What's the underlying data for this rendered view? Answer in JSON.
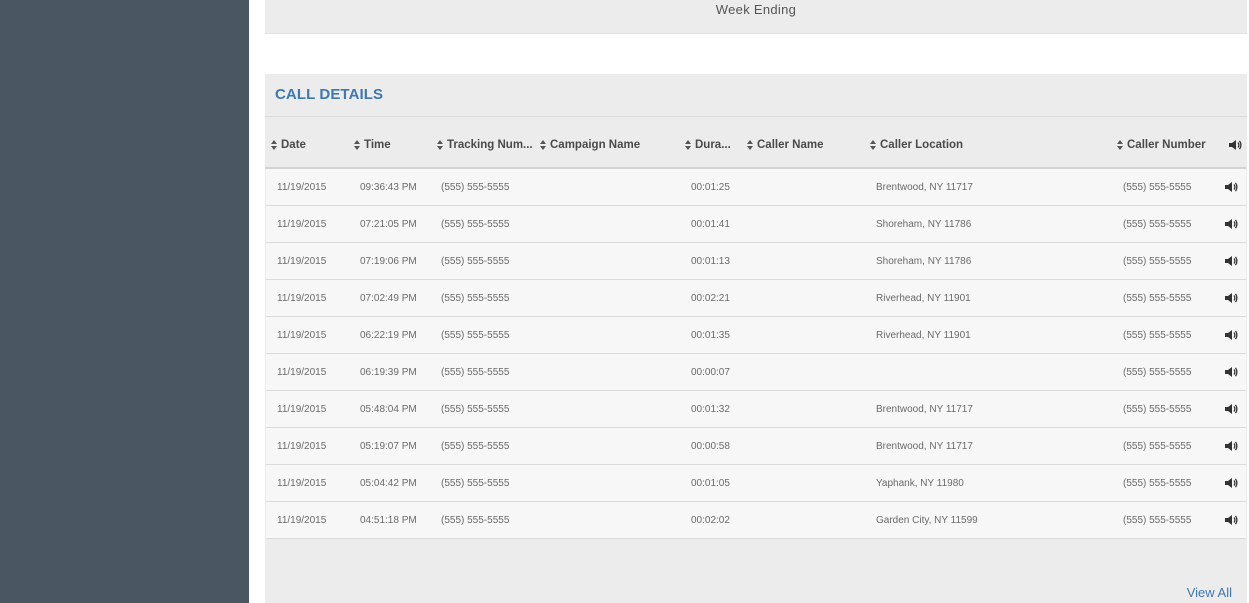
{
  "week_panel": {
    "label": "Week Ending"
  },
  "call_details": {
    "title": "CALL DETAILS",
    "columns": [
      {
        "key": "date",
        "label": "Date"
      },
      {
        "key": "time",
        "label": "Time"
      },
      {
        "key": "tracking",
        "label": "Tracking Num..."
      },
      {
        "key": "campaign",
        "label": "Campaign Name"
      },
      {
        "key": "duration",
        "label": "Dura..."
      },
      {
        "key": "caller_name",
        "label": "Caller Name"
      },
      {
        "key": "caller_location",
        "label": "Caller Location"
      },
      {
        "key": "caller_number",
        "label": "Caller Number"
      }
    ],
    "audio_icon": "speaker-icon",
    "rows": [
      {
        "date": "11/19/2015",
        "time": "09:36:43 PM",
        "tracking": "(555) 555-5555",
        "campaign": "",
        "duration": "00:01:25",
        "caller_name": "",
        "caller_location": "Brentwood, NY 11717",
        "caller_number": "(555) 555-5555"
      },
      {
        "date": "11/19/2015",
        "time": "07:21:05 PM",
        "tracking": "(555) 555-5555",
        "campaign": "",
        "duration": "00:01:41",
        "caller_name": "",
        "caller_location": "Shoreham, NY 11786",
        "caller_number": "(555) 555-5555"
      },
      {
        "date": "11/19/2015",
        "time": "07:19:06 PM",
        "tracking": "(555) 555-5555",
        "campaign": "",
        "duration": "00:01:13",
        "caller_name": "",
        "caller_location": "Shoreham, NY 11786",
        "caller_number": "(555) 555-5555"
      },
      {
        "date": "11/19/2015",
        "time": "07:02:49 PM",
        "tracking": "(555) 555-5555",
        "campaign": "",
        "duration": "00:02:21",
        "caller_name": "",
        "caller_location": "Riverhead, NY 11901",
        "caller_number": "(555) 555-5555"
      },
      {
        "date": "11/19/2015",
        "time": "06:22:19 PM",
        "tracking": "(555) 555-5555",
        "campaign": "",
        "duration": "00:01:35",
        "caller_name": "",
        "caller_location": "Riverhead, NY 11901",
        "caller_number": "(555) 555-5555"
      },
      {
        "date": "11/19/2015",
        "time": "06:19:39 PM",
        "tracking": "(555) 555-5555",
        "campaign": "",
        "duration": "00:00:07",
        "caller_name": "",
        "caller_location": "",
        "caller_number": "(555) 555-5555"
      },
      {
        "date": "11/19/2015",
        "time": "05:48:04 PM",
        "tracking": "(555) 555-5555",
        "campaign": "",
        "duration": "00:01:32",
        "caller_name": "",
        "caller_location": "Brentwood, NY 11717",
        "caller_number": "(555) 555-5555"
      },
      {
        "date": "11/19/2015",
        "time": "05:19:07 PM",
        "tracking": "(555) 555-5555",
        "campaign": "",
        "duration": "00:00:58",
        "caller_name": "",
        "caller_location": "Brentwood, NY 11717",
        "caller_number": "(555) 555-5555"
      },
      {
        "date": "11/19/2015",
        "time": "05:04:42 PM",
        "tracking": "(555) 555-5555",
        "campaign": "",
        "duration": "00:01:05",
        "caller_name": "",
        "caller_location": "Yaphank, NY 11980",
        "caller_number": "(555) 555-5555"
      },
      {
        "date": "11/19/2015",
        "time": "04:51:18 PM",
        "tracking": "(555) 555-5555",
        "campaign": "",
        "duration": "00:02:02",
        "caller_name": "",
        "caller_location": "Garden City, NY 11599",
        "caller_number": "(555) 555-5555"
      }
    ],
    "view_all_label": "View All"
  }
}
